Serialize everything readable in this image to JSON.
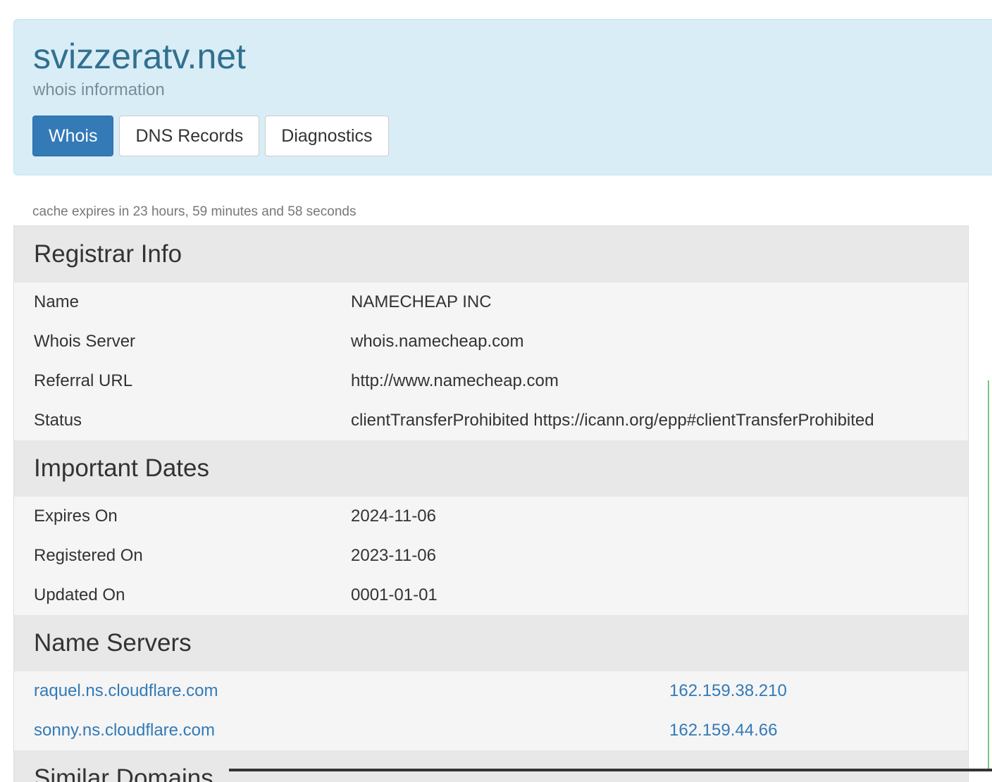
{
  "header": {
    "domain": "svizzeratv.net",
    "subtitle": "whois information",
    "tabs": [
      {
        "label": "Whois",
        "active": true
      },
      {
        "label": "DNS Records",
        "active": false
      },
      {
        "label": "Diagnostics",
        "active": false
      }
    ]
  },
  "cache_note": "cache expires in 23 hours, 59 minutes and 58 seconds",
  "registrar": {
    "title": "Registrar Info",
    "rows": [
      {
        "label": "Name",
        "value": "NAMECHEAP INC"
      },
      {
        "label": "Whois Server",
        "value": "whois.namecheap.com"
      },
      {
        "label": "Referral URL",
        "value": "http://www.namecheap.com"
      },
      {
        "label": "Status",
        "value": "clientTransferProhibited https://icann.org/epp#clientTransferProhibited"
      }
    ]
  },
  "dates": {
    "title": "Important Dates",
    "rows": [
      {
        "label": "Expires On",
        "value": "2024-11-06"
      },
      {
        "label": "Registered On",
        "value": "2023-11-06"
      },
      {
        "label": "Updated On",
        "value": "0001-01-01"
      }
    ]
  },
  "name_servers": {
    "title": "Name Servers",
    "rows": [
      {
        "host": "raquel.ns.cloudflare.com",
        "ip": "162.159.38.210"
      },
      {
        "host": "sonny.ns.cloudflare.com",
        "ip": "162.159.44.66"
      }
    ]
  },
  "similar": {
    "title": "Similar Domains"
  },
  "colors": {
    "accent": "#337ab7",
    "jumbotron_bg": "#d9edf7",
    "title_color": "#31708f",
    "link": "#337ab7"
  }
}
